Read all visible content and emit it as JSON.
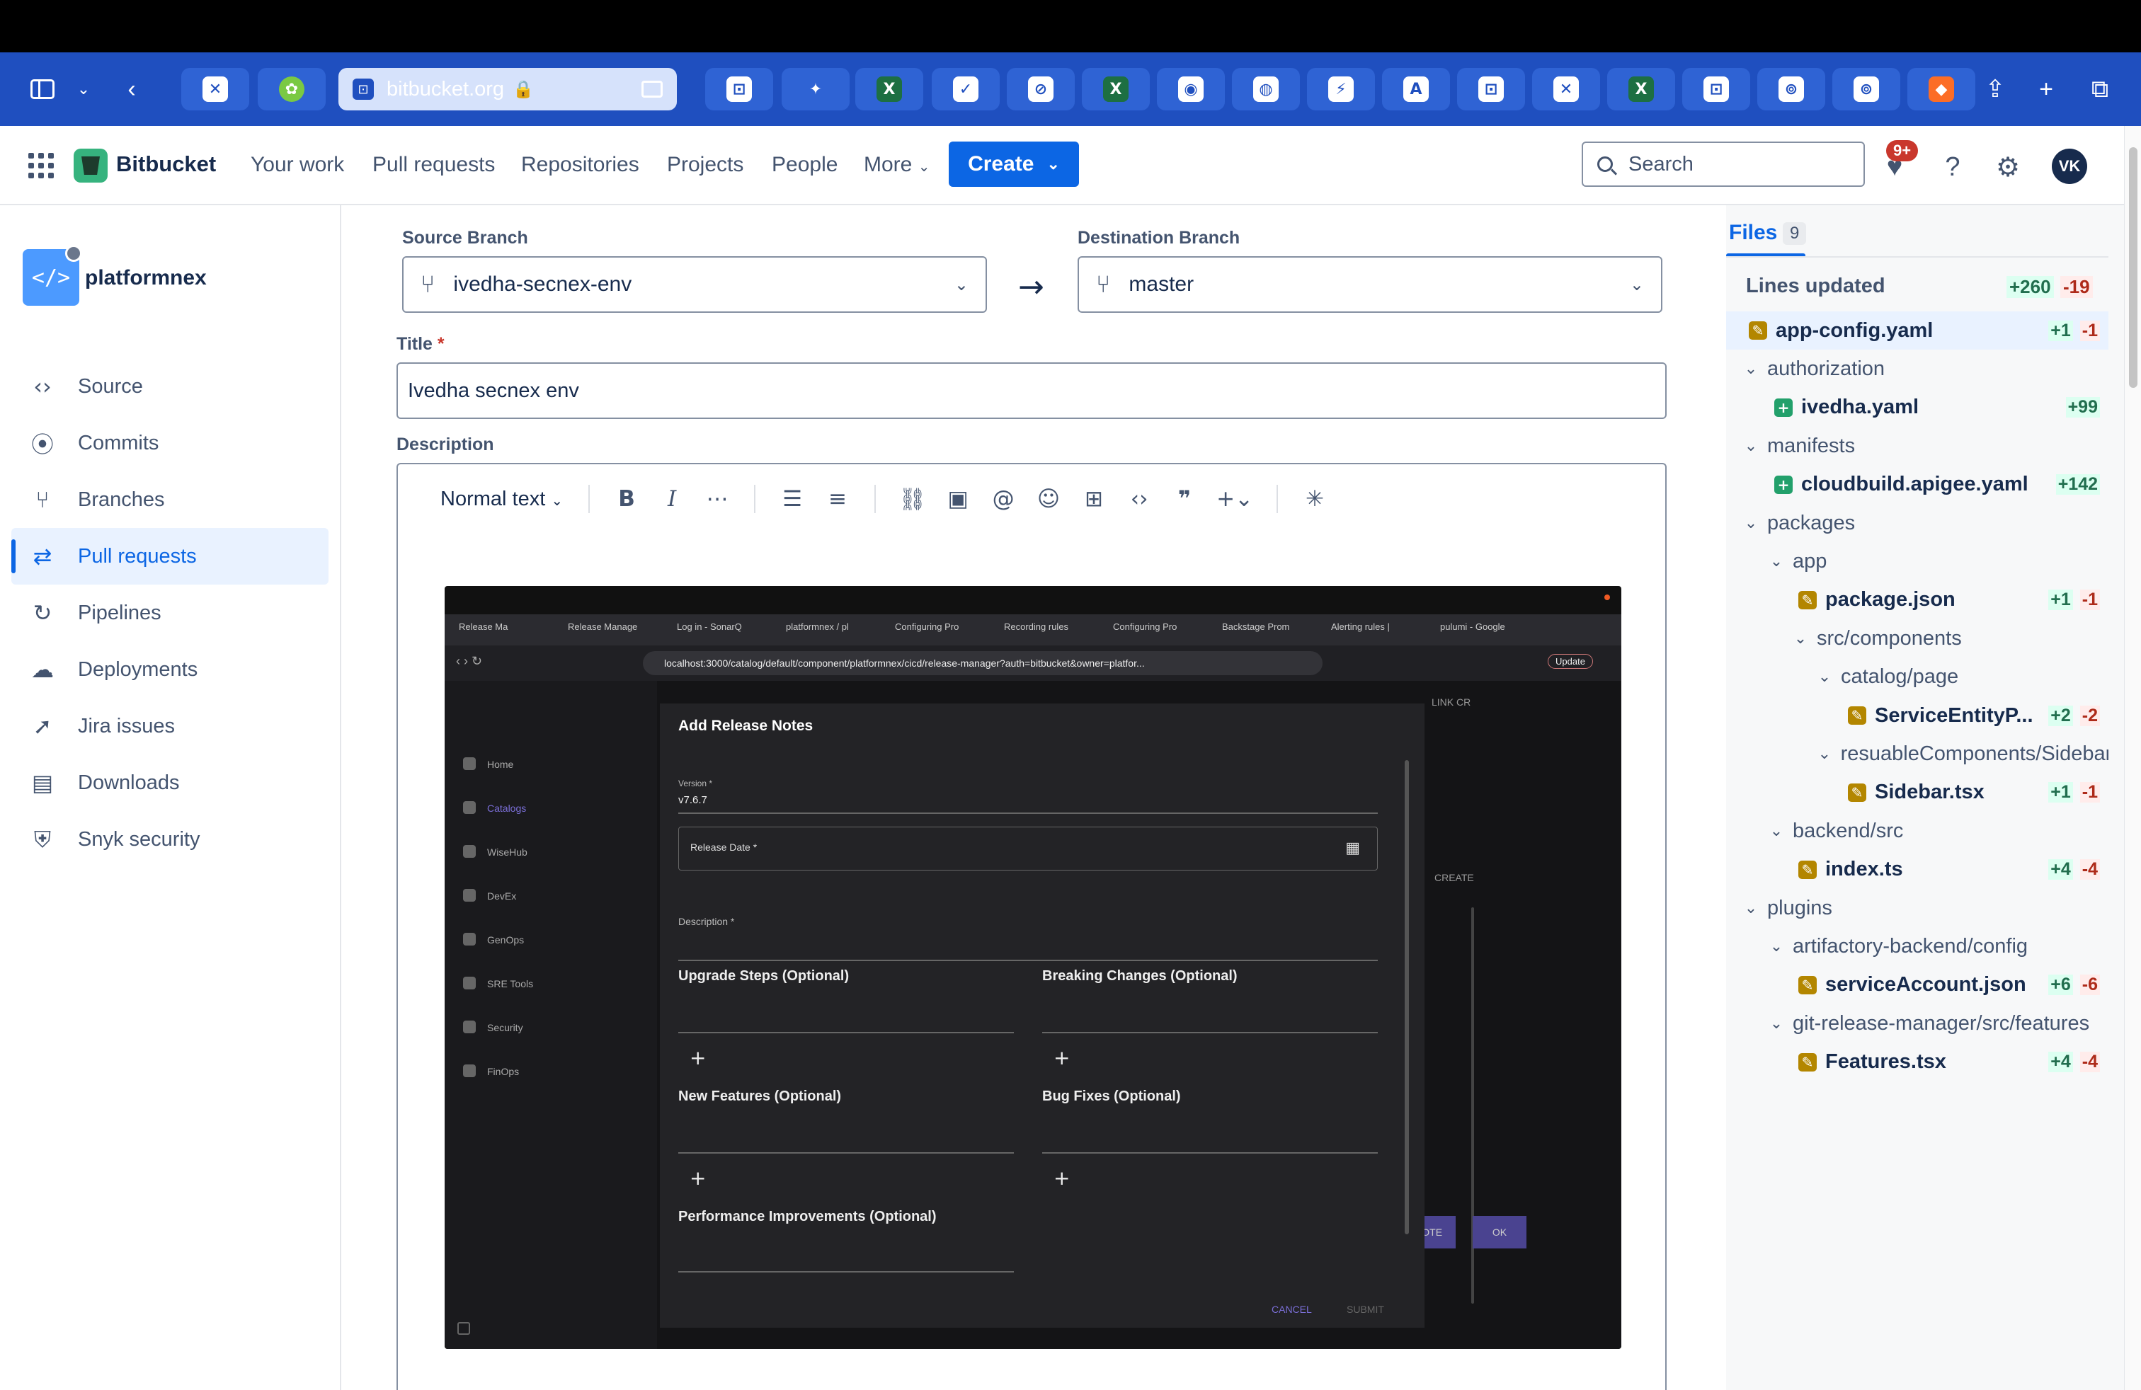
{
  "browser": {
    "address_url": "bitbucket.org",
    "tabs": [
      "confluence",
      "green-tool",
      "bitbucket",
      "gemini",
      "excel",
      "jira-app",
      "notion",
      "excel",
      "chrome",
      "globe",
      "linear",
      "anthropic",
      "bitbucket",
      "confluence",
      "excel",
      "bitbucket",
      "github",
      "github",
      "gitlab"
    ]
  },
  "header": {
    "product": "Bitbucket",
    "nav": [
      "Your work",
      "Pull requests",
      "Repositories",
      "Projects",
      "People",
      "More"
    ],
    "create_label": "Create",
    "search_placeholder": "Search",
    "notifications_badge": "9+",
    "avatar_initials": "VK"
  },
  "sidebar": {
    "repo_name": "platformnex",
    "items": [
      {
        "label": "Source",
        "icon": "code-icon"
      },
      {
        "label": "Commits",
        "icon": "commit-icon"
      },
      {
        "label": "Branches",
        "icon": "branch-icon"
      },
      {
        "label": "Pull requests",
        "icon": "pull-request-icon",
        "active": true
      },
      {
        "label": "Pipelines",
        "icon": "pipelines-icon"
      },
      {
        "label": "Deployments",
        "icon": "deployments-icon"
      },
      {
        "label": "Jira issues",
        "icon": "jira-icon"
      },
      {
        "label": "Downloads",
        "icon": "downloads-icon"
      },
      {
        "label": "Snyk security",
        "icon": "snyk-icon"
      }
    ]
  },
  "form": {
    "source_label": "Source Branch",
    "source_value": "ivedha-secnex-env",
    "dest_label": "Destination Branch",
    "dest_value": "master",
    "title_label": "Title",
    "title_value": "Ivedha secnex env",
    "description_label": "Description",
    "text_style": "Normal text"
  },
  "embedded": {
    "tabs": [
      "Release Ma",
      "Release Manage",
      "Log in - SonarQ",
      "platformnex / pl",
      "Configuring Pro",
      "Recording rules",
      "Configuring Pro",
      "Backstage Prom",
      "Alerting rules |",
      "pulumi - Google"
    ],
    "url": "localhost:3000/catalog/default/component/platformnex/cicd/release-manager?auth=bitbucket&owner=platfor...",
    "update_label": "Update",
    "side_items": [
      "Home",
      "Catalogs",
      "WiseHub",
      "DevEx",
      "GenOps",
      "SRE Tools",
      "Security",
      "FinOps"
    ],
    "bg_link_cr": "LINK CR",
    "bg_create": "CREATE",
    "bg_note_btn": "E NOTE",
    "bg_ok_btn": "OK",
    "modal": {
      "title": "Add Release Notes",
      "version_label": "Version *",
      "version_value": "v7.6.7",
      "release_date_label": "Release Date *",
      "description_label": "Description *",
      "upgrade_steps": "Upgrade Steps (Optional)",
      "breaking_changes": "Breaking Changes (Optional)",
      "new_features": "New Features (Optional)",
      "bug_fixes": "Bug Fixes (Optional)",
      "performance": "Performance Improvements (Optional)",
      "cancel": "CANCEL",
      "submit": "SUBMIT"
    }
  },
  "files": {
    "tab_label": "Files",
    "count": "9",
    "lines_updated_label": "Lines updated",
    "total_add": "+260",
    "total_del": "-19",
    "tree": [
      {
        "type": "file",
        "name": "app-config.yaml",
        "status": "modified",
        "add": "+1",
        "del": "-1",
        "depth": 0,
        "selected": true
      },
      {
        "type": "folder",
        "name": "authorization",
        "depth": 0
      },
      {
        "type": "file",
        "name": "ivedha.yaml",
        "status": "added",
        "add": "+99",
        "del": "",
        "depth": 1
      },
      {
        "type": "folder",
        "name": "manifests",
        "depth": 0
      },
      {
        "type": "file",
        "name": "cloudbuild.apigee.yaml",
        "status": "added",
        "add": "+142",
        "del": "",
        "depth": 1
      },
      {
        "type": "folder",
        "name": "packages",
        "depth": 0
      },
      {
        "type": "folder",
        "name": "app",
        "depth": 1
      },
      {
        "type": "file",
        "name": "package.json",
        "status": "modified",
        "add": "+1",
        "del": "-1",
        "depth": 2
      },
      {
        "type": "folder",
        "name": "src/components",
        "depth": 2
      },
      {
        "type": "folder",
        "name": "catalog/page",
        "depth": 3
      },
      {
        "type": "file",
        "name": "ServiceEntityP...",
        "status": "modified",
        "add": "+2",
        "del": "-2",
        "depth": 4
      },
      {
        "type": "folder",
        "name": "resuableComponents/Sidebar",
        "depth": 3
      },
      {
        "type": "file",
        "name": "Sidebar.tsx",
        "status": "modified",
        "add": "+1",
        "del": "-1",
        "depth": 4
      },
      {
        "type": "folder",
        "name": "backend/src",
        "depth": 1
      },
      {
        "type": "file",
        "name": "index.ts",
        "status": "modified",
        "add": "+4",
        "del": "-4",
        "depth": 2
      },
      {
        "type": "folder",
        "name": "plugins",
        "depth": 0
      },
      {
        "type": "folder",
        "name": "artifactory-backend/config",
        "depth": 1
      },
      {
        "type": "file",
        "name": "serviceAccount.json",
        "status": "modified",
        "add": "+6",
        "del": "-6",
        "depth": 2
      },
      {
        "type": "folder",
        "name": "git-release-manager/src/features",
        "depth": 1
      },
      {
        "type": "file",
        "name": "Features.tsx",
        "status": "modified",
        "add": "+4",
        "del": "-4",
        "depth": 2
      }
    ]
  },
  "colors": {
    "browser_bar": "#1f4fbf",
    "primary": "#0c66e4",
    "added": "#216e4e",
    "removed": "#ae2a19"
  }
}
